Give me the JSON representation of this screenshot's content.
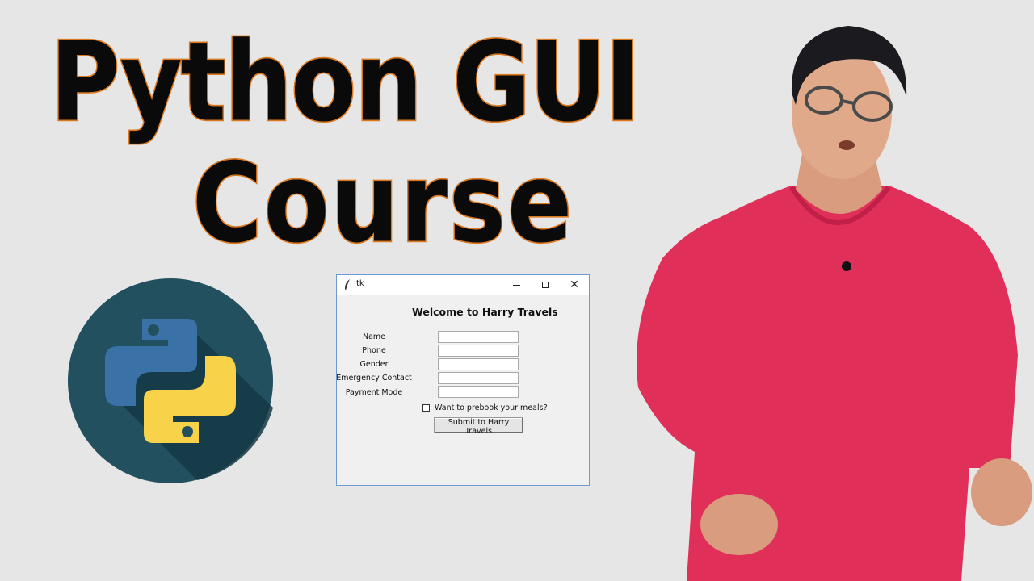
{
  "thumbnail": {
    "title_line1": "Python GUI",
    "title_line2": "Course"
  },
  "logo": {
    "icon": "python-logo-icon",
    "colors": {
      "circle": "#23505f",
      "blue": "#3a72a8",
      "yellow": "#f8d34a"
    }
  },
  "tk_window": {
    "title": "tk",
    "heading": "Welcome to Harry Travels",
    "fields": [
      {
        "label": "Name",
        "value": ""
      },
      {
        "label": "Phone",
        "value": ""
      },
      {
        "label": "Gender",
        "value": ""
      },
      {
        "label": "Emergency Contact",
        "value": ""
      },
      {
        "label": "Payment Mode",
        "value": ""
      }
    ],
    "checkbox_label": "Want to prebook your meals?",
    "checkbox_checked": false,
    "submit_label": "Submit to Harry Travels"
  },
  "colors": {
    "background": "#e6e6e6",
    "title_outline": "#d9781f",
    "shirt": "#e0305a"
  }
}
